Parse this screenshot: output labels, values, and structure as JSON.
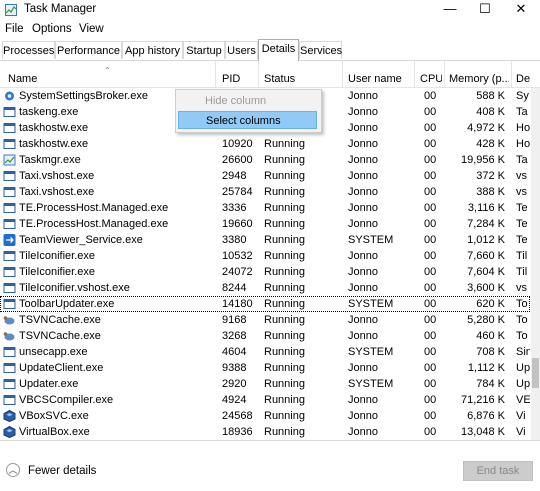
{
  "window": {
    "title": "Task Manager",
    "minimize": "—",
    "maximize": "☐",
    "close": "✕"
  },
  "menu": [
    "File",
    "Options",
    "View"
  ],
  "tabs": [
    "Processes",
    "Performance",
    "App history",
    "Startup",
    "Users",
    "Details",
    "Services"
  ],
  "active_tab": "Details",
  "columns": [
    "Name",
    "PID",
    "Status",
    "User name",
    "CPU",
    "Memory (p...",
    "De"
  ],
  "rows": [
    {
      "name": "SystemSettingsBroker.exe",
      "pid": "",
      "status": "",
      "user": "Jonno",
      "cpu": "00",
      "mem": "588 K",
      "desc": "Sy",
      "icon": "gear-icon"
    },
    {
      "name": "taskeng.exe",
      "pid": "",
      "status": "",
      "user": "Jonno",
      "cpu": "00",
      "mem": "408 K",
      "desc": "Ta",
      "icon": "window-icon"
    },
    {
      "name": "taskhostw.exe",
      "pid": "",
      "status": "",
      "user": "Jonno",
      "cpu": "00",
      "mem": "4,972 K",
      "desc": "Ho",
      "icon": "window-icon"
    },
    {
      "name": "taskhostw.exe",
      "pid": "10920",
      "status": "Running",
      "user": "Jonno",
      "cpu": "00",
      "mem": "428 K",
      "desc": "Ho",
      "icon": "window-icon"
    },
    {
      "name": "Taskmgr.exe",
      "pid": "26600",
      "status": "Running",
      "user": "Jonno",
      "cpu": "00",
      "mem": "19,956 K",
      "desc": "Ta",
      "icon": "taskmgr-icon"
    },
    {
      "name": "Taxi.vshost.exe",
      "pid": "2948",
      "status": "Running",
      "user": "Jonno",
      "cpu": "00",
      "mem": "372 K",
      "desc": "vs",
      "icon": "window-icon"
    },
    {
      "name": "Taxi.vshost.exe",
      "pid": "25784",
      "status": "Running",
      "user": "Jonno",
      "cpu": "00",
      "mem": "388 K",
      "desc": "vs",
      "icon": "window-icon"
    },
    {
      "name": "TE.ProcessHost.Managed.exe",
      "pid": "3336",
      "status": "Running",
      "user": "Jonno",
      "cpu": "00",
      "mem": "3,116 K",
      "desc": "Te",
      "icon": "window-icon"
    },
    {
      "name": "TE.ProcessHost.Managed.exe",
      "pid": "19660",
      "status": "Running",
      "user": "Jonno",
      "cpu": "00",
      "mem": "7,284 K",
      "desc": "Te",
      "icon": "window-icon"
    },
    {
      "name": "TeamViewer_Service.exe",
      "pid": "3380",
      "status": "Running",
      "user": "SYSTEM",
      "cpu": "00",
      "mem": "1,012 K",
      "desc": "Te",
      "icon": "teamviewer-icon"
    },
    {
      "name": "TileIconifier.exe",
      "pid": "10532",
      "status": "Running",
      "user": "Jonno",
      "cpu": "00",
      "mem": "7,660 K",
      "desc": "Til",
      "icon": "window-icon"
    },
    {
      "name": "TileIconifier.exe",
      "pid": "24072",
      "status": "Running",
      "user": "Jonno",
      "cpu": "00",
      "mem": "7,604 K",
      "desc": "Til",
      "icon": "window-icon"
    },
    {
      "name": "TileIconifier.vshost.exe",
      "pid": "8244",
      "status": "Running",
      "user": "Jonno",
      "cpu": "00",
      "mem": "3,600 K",
      "desc": "vs",
      "icon": "window-icon"
    },
    {
      "name": "ToolbarUpdater.exe",
      "pid": "14180",
      "status": "Running",
      "user": "SYSTEM",
      "cpu": "00",
      "mem": "620 K",
      "desc": "To",
      "icon": "window-icon"
    },
    {
      "name": "TSVNCache.exe",
      "pid": "9168",
      "status": "Running",
      "user": "Jonno",
      "cpu": "00",
      "mem": "5,280 K",
      "desc": "To",
      "icon": "tortoise-icon"
    },
    {
      "name": "TSVNCache.exe",
      "pid": "3268",
      "status": "Running",
      "user": "Jonno",
      "cpu": "00",
      "mem": "460 K",
      "desc": "To",
      "icon": "tortoise-icon"
    },
    {
      "name": "unsecapp.exe",
      "pid": "4604",
      "status": "Running",
      "user": "SYSTEM",
      "cpu": "00",
      "mem": "708 K",
      "desc": "Sin",
      "icon": "window-icon"
    },
    {
      "name": "UpdateClient.exe",
      "pid": "9388",
      "status": "Running",
      "user": "Jonno",
      "cpu": "00",
      "mem": "1,112 K",
      "desc": "Up",
      "icon": "window-icon"
    },
    {
      "name": "Updater.exe",
      "pid": "2920",
      "status": "Running",
      "user": "SYSTEM",
      "cpu": "00",
      "mem": "784 K",
      "desc": "Up",
      "icon": "window-icon"
    },
    {
      "name": "VBCSCompiler.exe",
      "pid": "4924",
      "status": "Running",
      "user": "Jonno",
      "cpu": "00",
      "mem": "71,216 K",
      "desc": "VE",
      "icon": "window-icon"
    },
    {
      "name": "VBoxSVC.exe",
      "pid": "24568",
      "status": "Running",
      "user": "Jonno",
      "cpu": "00",
      "mem": "6,876 K",
      "desc": "Vi",
      "icon": "vbox-icon"
    },
    {
      "name": "VirtualBox.exe",
      "pid": "18936",
      "status": "Running",
      "user": "Jonno",
      "cpu": "00",
      "mem": "13,048 K",
      "desc": "Vi",
      "icon": "vbox-icon"
    }
  ],
  "focused_row": 13,
  "context_menu": {
    "hide_column": "Hide column",
    "select_columns": "Select columns"
  },
  "footer": {
    "fewer_details": "Fewer details",
    "end_task": "End task"
  },
  "colors": {
    "highlight": "#91c9f7",
    "tab_border": "#adadad",
    "disabled_text": "#9a9a9a"
  }
}
